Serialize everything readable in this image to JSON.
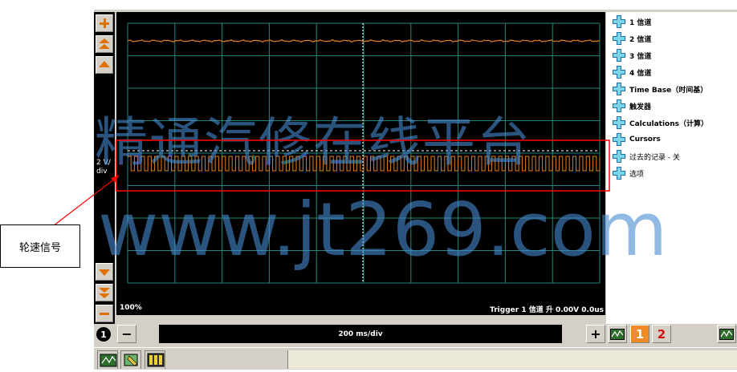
{
  "scope": {
    "voltage_label": "2 V/\ndiv",
    "trigger_marker": "T",
    "zoom": "100%",
    "trigger_status": "Trigger 1 信道 升 0.00V 0.0us",
    "timebase": "200 ms/div",
    "trace_color": "#e08020"
  },
  "panel": {
    "items": [
      {
        "label": "1 信道"
      },
      {
        "label": "2 信道"
      },
      {
        "label": "3 信道"
      },
      {
        "label": "4 信道"
      },
      {
        "label": "Time Base（时间基）"
      },
      {
        "label": "触发器"
      },
      {
        "label": "Calculations（计算）"
      },
      {
        "label": "Cursors"
      },
      {
        "label": "过去的记录 - 关"
      },
      {
        "label": "选项"
      }
    ]
  },
  "toolbar": {
    "plus_label": "+",
    "minus_label": "−",
    "channel_badge": "1",
    "ch1_label": "1",
    "ch2_label": "2",
    "circle_label": "1"
  },
  "annotation": {
    "callout_label": "轮速信号",
    "highlight_color": "#ff0000"
  },
  "watermark": {
    "line1": "精通汽修在线平台",
    "line2": "www.jt269.com"
  }
}
